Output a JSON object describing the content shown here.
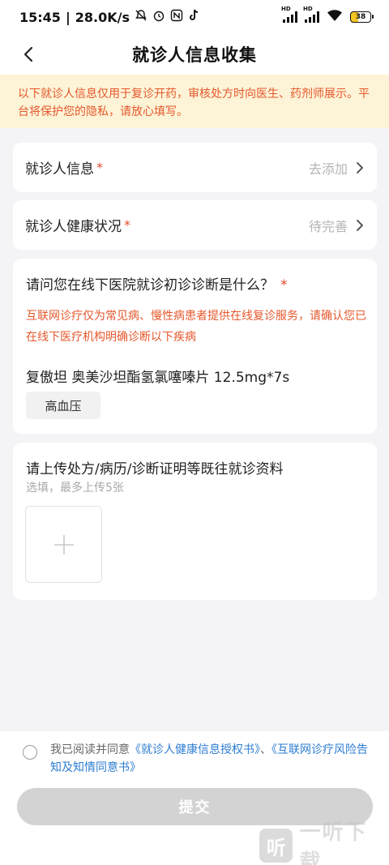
{
  "status_bar": {
    "time": "15:45",
    "network_speed": "28.0K/s",
    "battery": "38",
    "left_icons": [
      "bell-off-icon",
      "alarm-icon",
      "nfc-icon",
      "tiktok-icon"
    ],
    "right_icons": [
      "signal-hd-icon",
      "signal-hd-icon",
      "wifi-icon",
      "battery-icon"
    ]
  },
  "header": {
    "title": "就诊人信息收集",
    "back_icon": "chevron-left-icon"
  },
  "notice": {
    "text": "以下就诊人信息仅用于复诊开药，审核处方时向医生、药剂师展示。平台将保护您的隐私，请放心填写。"
  },
  "patient_info": {
    "label": "就诊人信息",
    "required_mark": "*",
    "value": "去添加"
  },
  "health_status": {
    "label": "就诊人健康状况",
    "required_mark": "*",
    "value": "待完善"
  },
  "diagnosis": {
    "question": "请问您在线下医院就诊初诊诊断是什么？",
    "required_mark": "*",
    "warning": "互联网诊疗仅为常见病、慢性病患者提供在线复诊服务，请确认您已在线下医疗机构明确诊断以下疾病",
    "drug": "复傲坦 奥美沙坦酯氢氯噻嗪片 12.5mg*7s",
    "tag": "高血压"
  },
  "upload": {
    "title": "请上传处方/病历/诊断证明等既往就诊资料",
    "hint": "选填，最多上传5张"
  },
  "agreement": {
    "prefix": "我已阅读并同意",
    "link1": "《就诊人健康信息授权书》",
    "separator": "、",
    "link2": "《互联网诊疗风险告知及知情同意书》"
  },
  "submit": {
    "label": "提交"
  },
  "watermark": {
    "logo": "听",
    "text": "一听下载"
  },
  "colors": {
    "accent_orange": "#e5582d",
    "link_blue": "#2d7dd2",
    "notice_bg": "#fdf3d6",
    "disabled_button": "#d3d3d3"
  }
}
